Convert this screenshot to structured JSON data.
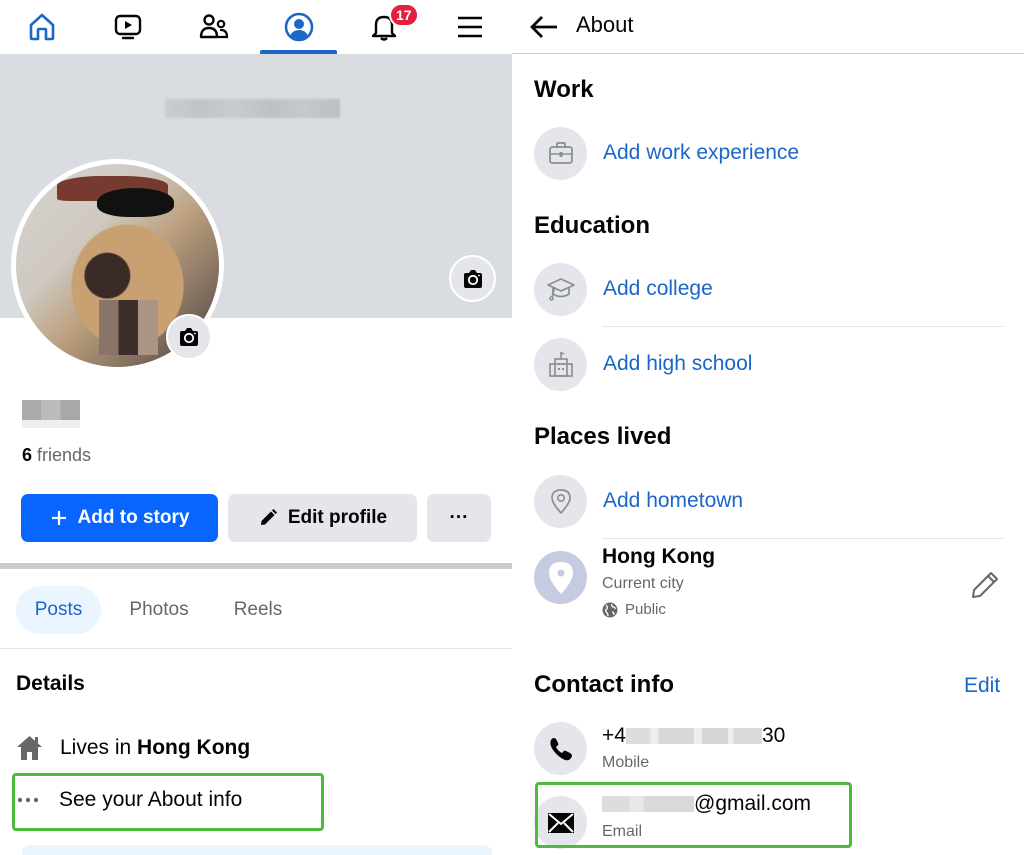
{
  "left": {
    "nav": {
      "items": [
        {
          "name": "home",
          "icon": "home-icon"
        },
        {
          "name": "video",
          "icon": "video-icon"
        },
        {
          "name": "friends",
          "icon": "friends-icon"
        },
        {
          "name": "profile",
          "icon": "profile-icon",
          "active": true
        },
        {
          "name": "notifications",
          "icon": "bell-icon",
          "badge": "17"
        },
        {
          "name": "menu",
          "icon": "menu-icon"
        }
      ],
      "notification_badge": "17"
    },
    "profile": {
      "friends_count": "6",
      "friends_label": " friends"
    },
    "buttons": {
      "add_story": "Add to story",
      "edit_profile": "Edit profile",
      "more": "···"
    },
    "tabs": [
      {
        "label": "Posts",
        "active": true
      },
      {
        "label": "Photos"
      },
      {
        "label": "Reels"
      }
    ],
    "details": {
      "heading": "Details",
      "lives_prefix": "Lives in ",
      "lives_city": "Hong Kong",
      "see_about": "See your About info"
    }
  },
  "right": {
    "header": {
      "title": "About"
    },
    "sections": {
      "work": {
        "heading": "Work",
        "add_work": "Add work experience"
      },
      "education": {
        "heading": "Education",
        "add_college": "Add college",
        "add_high_school": "Add high school"
      },
      "places": {
        "heading": "Places lived",
        "add_hometown": "Add hometown",
        "current_city": {
          "name": "Hong Kong",
          "label": "Current city",
          "privacy": "Public"
        }
      },
      "contact": {
        "heading": "Contact info",
        "edit": "Edit",
        "phone_prefix": "+4",
        "phone_suffix": "30",
        "phone_label": "Mobile",
        "email_suffix": "@gmail.com",
        "email_label": "Email"
      }
    }
  },
  "colors": {
    "accent": "#0866ff",
    "link": "#1b66c9",
    "highlight": "#4cbb3a",
    "badge": "#e41e3f"
  }
}
